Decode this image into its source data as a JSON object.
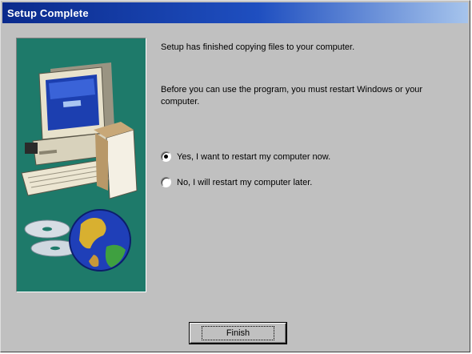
{
  "window": {
    "title": "Setup Complete"
  },
  "content": {
    "message_copied": "Setup has finished copying files to your computer.",
    "message_restart": "Before you can use the program, you must restart Windows or your computer."
  },
  "options": [
    {
      "label": "Yes, I want to restart my computer now.",
      "selected": true
    },
    {
      "label": "No, I will restart my computer later.",
      "selected": false
    }
  ],
  "buttons": {
    "finish_label": "Finish"
  },
  "colors": {
    "title_start": "#0a2a8c",
    "title_end": "#a6c4ec",
    "dialog_face": "#c0c0c0",
    "art_background": "#1e7a6a"
  }
}
